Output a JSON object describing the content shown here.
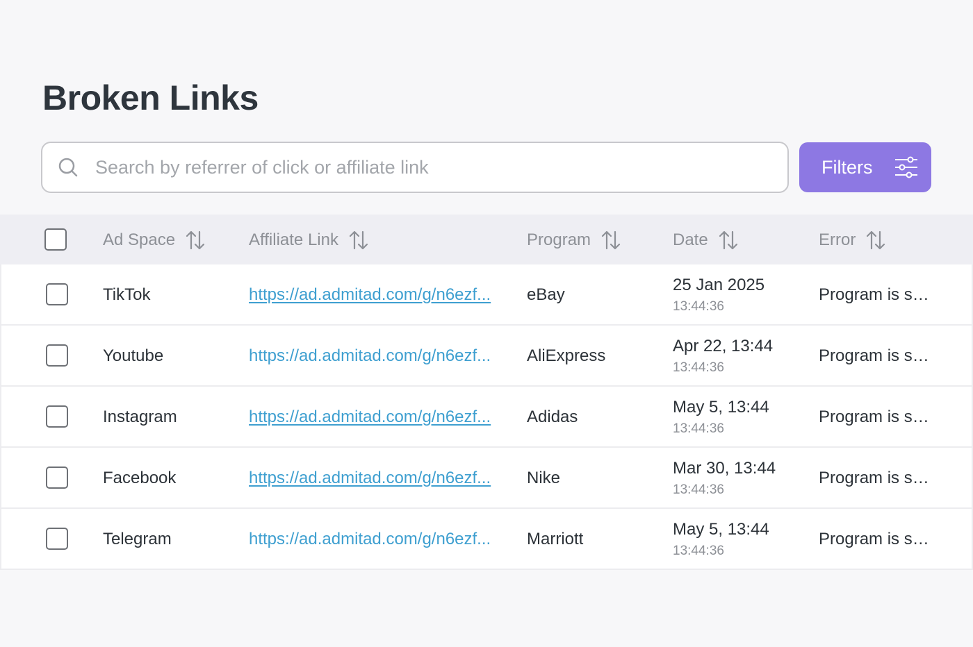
{
  "page": {
    "title": "Broken Links"
  },
  "search": {
    "placeholder": "Search by referrer of click or affiliate link",
    "value": ""
  },
  "filters": {
    "label": "Filters"
  },
  "table": {
    "columns": [
      "Ad Space",
      "Affiliate Link",
      "Program",
      "Date",
      "Error"
    ],
    "rows": [
      {
        "ad_space": "TikTok",
        "link": "https://ad.admitad.com/g/n6ezf...",
        "link_underlined": true,
        "program": "eBay",
        "date": "25 Jan 2025",
        "time": "13:44:36",
        "error": "Program is su..."
      },
      {
        "ad_space": "Youtube",
        "link": "https://ad.admitad.com/g/n6ezf...",
        "link_underlined": false,
        "program": "AliExpress",
        "date": "Apr 22, 13:44",
        "time": "13:44:36",
        "error": "Program is su..."
      },
      {
        "ad_space": "Instagram",
        "link": "https://ad.admitad.com/g/n6ezf...",
        "link_underlined": true,
        "program": "Adidas",
        "date": "May 5, 13:44",
        "time": "13:44:36",
        "error": "Program is su..."
      },
      {
        "ad_space": "Facebook",
        "link": "https://ad.admitad.com/g/n6ezf...",
        "link_underlined": true,
        "program": "Nike",
        "date": "Mar 30, 13:44",
        "time": "13:44:36",
        "error": "Program is su..."
      },
      {
        "ad_space": "Telegram",
        "link": "https://ad.admitad.com/g/n6ezf...",
        "link_underlined": false,
        "program": "Marriott",
        "date": "May 5, 13:44",
        "time": "13:44:36",
        "error": "Program is su..."
      }
    ]
  },
  "colors": {
    "accent": "#8d78e3",
    "link": "#3e9fd0",
    "header_bg": "#eeeef3",
    "page_bg": "#f7f7f9"
  },
  "icons": {
    "search": "search-icon",
    "filters": "sliders-icon",
    "sort": "sort-arrows-icon"
  }
}
